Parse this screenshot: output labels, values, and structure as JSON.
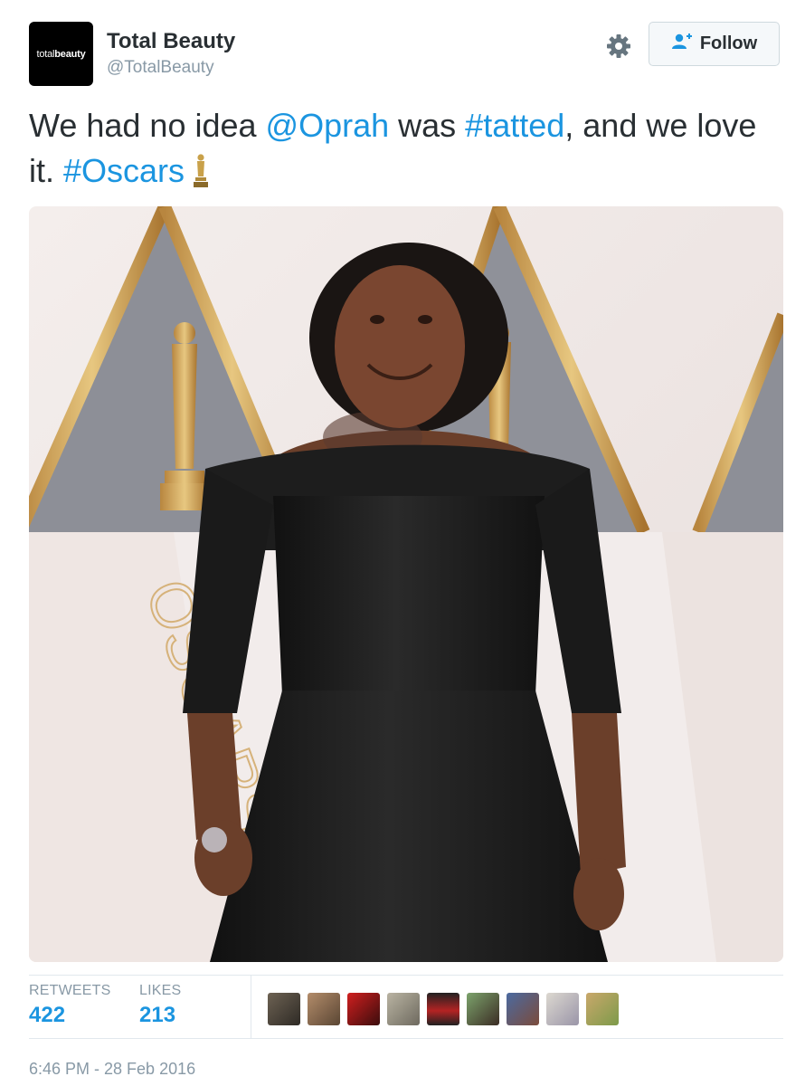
{
  "account": {
    "avatar_text_light": "total",
    "avatar_text_bold": "beauty",
    "name": "Total Beauty",
    "handle": "@TotalBeauty"
  },
  "actions": {
    "follow_label": "Follow",
    "settings_icon": "gear-icon",
    "follow_icon": "add-user-icon"
  },
  "tweet": {
    "part1": "We had no idea ",
    "mention": "@Oprah",
    "part2": " was ",
    "hashtag1": "#tatted",
    "part3": ", and we love it. ",
    "hashtag2": "#Oscars",
    "emoji": "oscar-statuette-icon",
    "image_wall_text": "OSCARS"
  },
  "stats": {
    "retweets_label": "RETWEETS",
    "retweets_count": "422",
    "likes_label": "LIKES",
    "likes_count": "213"
  },
  "likers_count_shown": 10,
  "timestamp": "6:46 PM - 28 Feb 2016",
  "colors": {
    "link": "#1b95e0",
    "text": "#292f33",
    "muted": "#8899a6",
    "gold": "#c9a14a"
  }
}
